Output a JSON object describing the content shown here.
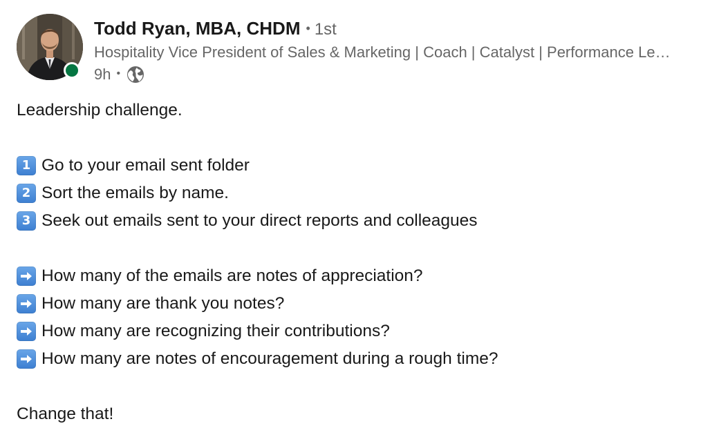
{
  "author": {
    "name": "Todd Ryan, MBA, CHDM",
    "separator": "•",
    "connection_degree": "1st",
    "headline": "Hospitality Vice President of Sales & Marketing | Coach | Catalyst | Performance Leader",
    "post_age": "9h",
    "meta_separator": "•",
    "visibility_icon": "globe-icon",
    "presence_color": "#057642"
  },
  "post": {
    "intro": "Leadership challenge.",
    "steps": [
      {
        "badge": "1",
        "text": "Go to your email sent folder"
      },
      {
        "badge": "2",
        "text": "Sort the emails by name."
      },
      {
        "badge": "3",
        "text": "Seek out emails sent to your direct reports and colleagues"
      }
    ],
    "questions": [
      {
        "icon": "right-arrow-icon",
        "text": "How many of the emails are notes of appreciation?"
      },
      {
        "icon": "right-arrow-icon",
        "text": "How many are thank you notes?"
      },
      {
        "icon": "right-arrow-icon",
        "text": "How many are recognizing their contributions?"
      },
      {
        "icon": "right-arrow-icon",
        "text": "How many are notes of encouragement during a rough time?"
      }
    ],
    "closing": "Change that!"
  }
}
